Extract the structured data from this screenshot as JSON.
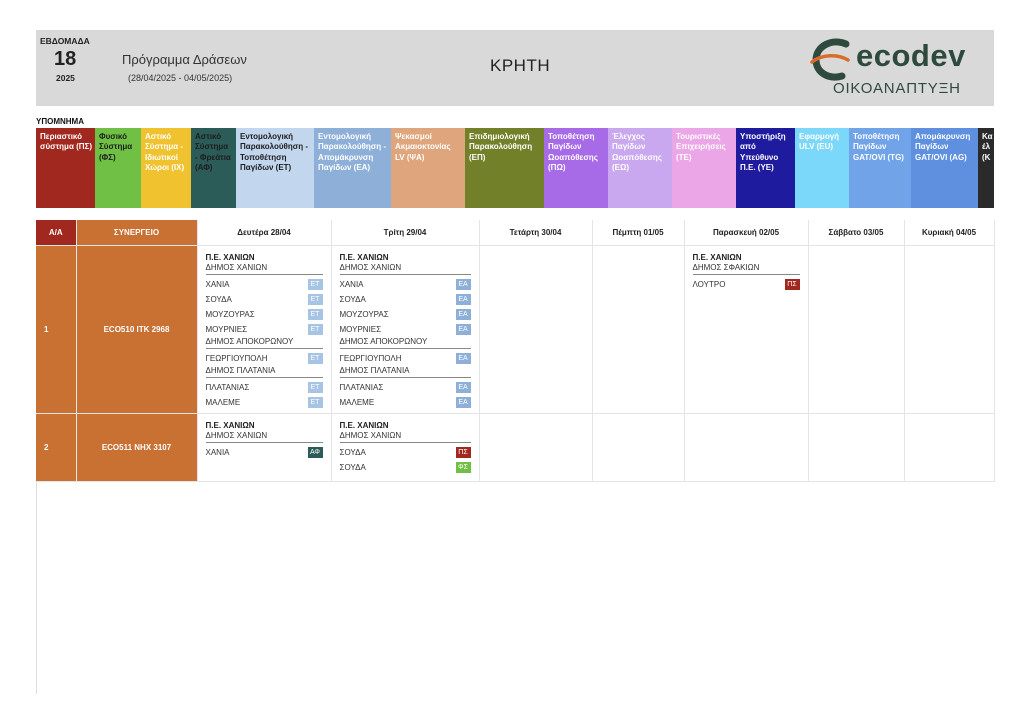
{
  "header": {
    "week_label": "ΕΒΔΟΜΑΔΑ",
    "week_number": "18",
    "year": "2025",
    "program_title": "Πρόγραμμα Δράσεων",
    "date_range": "(28/04/2025 - 04/05/2025)",
    "region": "ΚΡΗΤΗ",
    "logo_word": "ecodev",
    "logo_sub": "ΟΙΚΟΑΝΑΠΤΥΞΗ"
  },
  "legend": {
    "title": "ΥΠΟΜΝΗΜΑ",
    "items": [
      {
        "label": "Περιαστικό σύστημα (ΠΣ)",
        "bg": "#a1281e",
        "fg": "#ffffff"
      },
      {
        "label": "Φυσικό Σύστημα (ΦΣ)",
        "bg": "#6fc044",
        "fg": "#1d1d1d"
      },
      {
        "label": "Αστικό Σύστημα - Ιδιωτικοί Χώροι (ΙΧ)",
        "bg": "#f1c230",
        "fg": "#ffffff"
      },
      {
        "label": "Αστικό Σύστημα - Φρεάτια (ΑΦ)",
        "bg": "#2b5c57",
        "fg": "#1d1d1d"
      },
      {
        "label": "Εντομολογική Παρακολούθηση - Τοποθέτηση Παγίδων (ΕΤ)",
        "bg": "#c2d6ee",
        "fg": "#1d1d1d"
      },
      {
        "label": "Εντομολογική Παρακολούθηση - Απομάκρυνση Παγίδων (ΕΑ)",
        "bg": "#8eb0d8",
        "fg": "#ffffff"
      },
      {
        "label": "Ψεκασμοί Ακμαιοκτονίας LV (ΨΑ)",
        "bg": "#dfa57c",
        "fg": "#ffffff"
      },
      {
        "label": "Επιδημιολογική Παρακολούθηση (ΕΠ)",
        "bg": "#72802a",
        "fg": "#ffffff"
      },
      {
        "label": "Τοποθέτηση Παγίδων Ωοαπόθεσης (ΠΩ)",
        "bg": "#a76be8",
        "fg": "#ffffff"
      },
      {
        "label": "Έλεγχος Παγίδων Ωοαπόθεσης (ΕΩ)",
        "bg": "#c9a8f0",
        "fg": "#ffffff"
      },
      {
        "label": "Τουριστικές Επιχειρήσεις (ΤΕ)",
        "bg": "#eaa6e6",
        "fg": "#ffffff"
      },
      {
        "label": "Υποστήριξη από Υπεύθυνο Π.Ε. (ΥΕ)",
        "bg": "#1f1b9e",
        "fg": "#ffffff"
      },
      {
        "label": "Εφαρμογή ULV (EU)",
        "bg": "#7cd8fa",
        "fg": "#ffffff"
      },
      {
        "label": "Τοποθέτηση Παγίδων GAT/OVI (TG)",
        "bg": "#71a3e8",
        "fg": "#ffffff"
      },
      {
        "label": "Απομάκρυνση Παγίδων GAT/OVI (AG)",
        "bg": "#5f90e0",
        "fg": "#ffffff"
      },
      {
        "label": "Κα έλ (Κ",
        "bg": "#2a2a2a",
        "fg": "#ffffff"
      }
    ]
  },
  "table": {
    "headers": [
      "Α/Α",
      "ΣΥΝΕΡΓΕΙΟ",
      "Δευτέρα 28/04",
      "Τρίτη 29/04",
      "Τετάρτη 30/04",
      "Πέμπτη 01/05",
      "Παρασκευή 02/05",
      "Σάββατο 03/05",
      "Κυριακή 04/05"
    ],
    "rows": [
      {
        "aa": "1",
        "team": "ECO510  ΙΤΚ 2968",
        "days": [
          [
            {
              "pe": "Π.Ε. ΧΑΝΙΩΝ",
              "groups": [
                {
                  "dimos": "ΔΗΜΟΣ ΧΑΝΙΩΝ",
                  "locations": [
                    {
                      "name": "ΧΑΝΙΑ",
                      "tag": "ΕΤ",
                      "cls": "ET"
                    },
                    {
                      "name": "ΣΟΥΔΑ",
                      "tag": "ΕΤ",
                      "cls": "ET"
                    },
                    {
                      "name": "ΜΟΥΖΟΥΡΑΣ",
                      "tag": "ΕΤ",
                      "cls": "ET"
                    },
                    {
                      "name": "ΜΟΥΡΝΙΕΣ",
                      "tag": "ΕΤ",
                      "cls": "ET"
                    }
                  ]
                },
                {
                  "dimos": "ΔΗΜΟΣ ΑΠΟΚΟΡΩΝΟΥ",
                  "locations": [
                    {
                      "name": "ΓΕΩΡΓΙΟΥΠΟΛΗ",
                      "tag": "ΕΤ",
                      "cls": "ET"
                    }
                  ]
                },
                {
                  "dimos": "ΔΗΜΟΣ ΠΛΑΤΑΝΙΑ",
                  "locations": [
                    {
                      "name": "ΠΛΑΤΑΝΙΑΣ",
                      "tag": "ΕΤ",
                      "cls": "ET"
                    },
                    {
                      "name": "ΜΑΛΕΜΕ",
                      "tag": "ΕΤ",
                      "cls": "ET"
                    }
                  ]
                }
              ]
            }
          ],
          [
            {
              "pe": "Π.Ε. ΧΑΝΙΩΝ",
              "groups": [
                {
                  "dimos": "ΔΗΜΟΣ ΧΑΝΙΩΝ",
                  "locations": [
                    {
                      "name": "ΧΑΝΙΑ",
                      "tag": "ΕΑ",
                      "cls": "EA"
                    },
                    {
                      "name": "ΣΟΥΔΑ",
                      "tag": "ΕΑ",
                      "cls": "EA"
                    },
                    {
                      "name": "ΜΟΥΖΟΥΡΑΣ",
                      "tag": "ΕΑ",
                      "cls": "EA"
                    },
                    {
                      "name": "ΜΟΥΡΝΙΕΣ",
                      "tag": "ΕΑ",
                      "cls": "EA"
                    }
                  ]
                },
                {
                  "dimos": "ΔΗΜΟΣ ΑΠΟΚΟΡΩΝΟΥ",
                  "locations": [
                    {
                      "name": "ΓΕΩΡΓΙΟΥΠΟΛΗ",
                      "tag": "ΕΑ",
                      "cls": "EA"
                    }
                  ]
                },
                {
                  "dimos": "ΔΗΜΟΣ ΠΛΑΤΑΝΙΑ",
                  "locations": [
                    {
                      "name": "ΠΛΑΤΑΝΙΑΣ",
                      "tag": "ΕΑ",
                      "cls": "EA"
                    },
                    {
                      "name": "ΜΑΛΕΜΕ",
                      "tag": "ΕΑ",
                      "cls": "EA"
                    }
                  ]
                }
              ]
            }
          ],
          [],
          [],
          [
            {
              "pe": "Π.Ε. ΧΑΝΙΩΝ",
              "groups": [
                {
                  "dimos": "ΔΗΜΟΣ ΣΦΑΚΙΩΝ",
                  "locations": [
                    {
                      "name": "ΛΟΥΤΡΟ",
                      "tag": "ΠΣ",
                      "cls": "PS"
                    }
                  ]
                }
              ]
            }
          ],
          [],
          []
        ]
      },
      {
        "aa": "2",
        "team": "ECO511  ΝΗΧ 3107",
        "days": [
          [
            {
              "pe": "Π.Ε. ΧΑΝΙΩΝ",
              "groups": [
                {
                  "dimos": "ΔΗΜΟΣ ΧΑΝΙΩΝ",
                  "locations": [
                    {
                      "name": "ΧΑΝΙΑ",
                      "tag": "ΑΦ",
                      "cls": "AF"
                    }
                  ]
                }
              ]
            }
          ],
          [
            {
              "pe": "Π.Ε. ΧΑΝΙΩΝ",
              "groups": [
                {
                  "dimos": "ΔΗΜΟΣ ΧΑΝΙΩΝ",
                  "locations": [
                    {
                      "name": "ΣΟΥΔΑ",
                      "tag": "ΠΣ",
                      "cls": "PS"
                    },
                    {
                      "name": "ΣΟΥΔΑ",
                      "tag": "ΦΣ",
                      "cls": "FS"
                    }
                  ]
                }
              ]
            }
          ],
          [],
          [],
          [],
          [],
          []
        ]
      }
    ]
  }
}
